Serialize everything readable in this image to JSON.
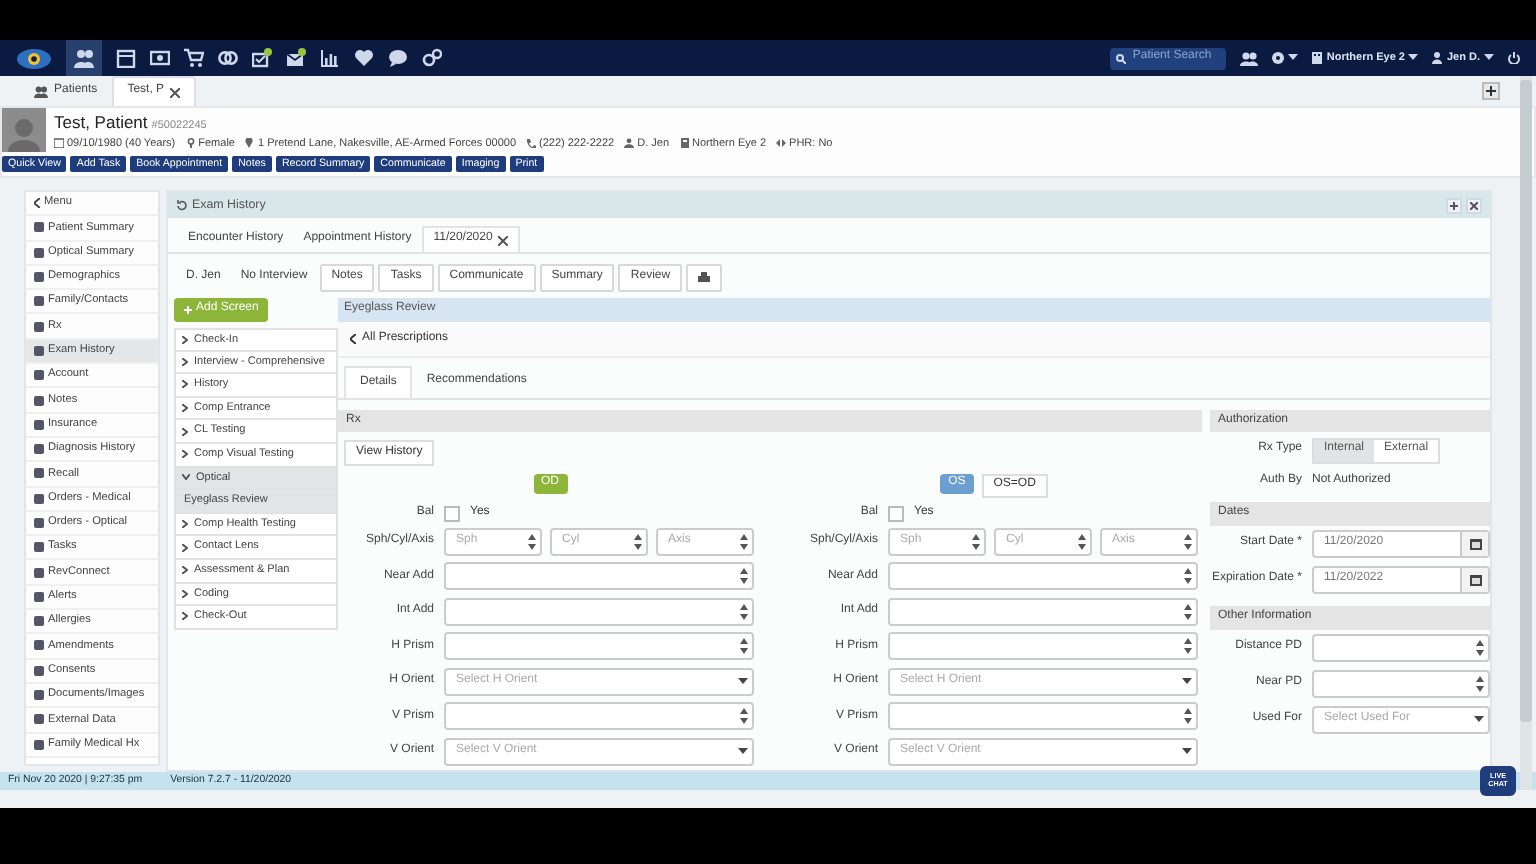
{
  "nav": {
    "search_placeholder": "Patient Search",
    "location": "Northern Eye 2",
    "user": "Jen D."
  },
  "tabs": [
    {
      "label": "Patients",
      "selected": false,
      "closable": false
    },
    {
      "label": "Test, P",
      "selected": true,
      "closable": true
    }
  ],
  "patient": {
    "name": "Test, Patient",
    "id": "#50022245",
    "details": [
      {
        "kind": "dob",
        "text": "09/10/1980 (40 Years)"
      },
      {
        "kind": "sex",
        "text": "Female"
      },
      {
        "kind": "address",
        "text": "1 Pretend Lane, Nakesville, AE-Armed Forces 00000"
      },
      {
        "kind": "phone",
        "text": "(222) 222-2222"
      },
      {
        "kind": "provider",
        "text": "D. Jen"
      },
      {
        "kind": "location",
        "text": "Northern Eye 2"
      },
      {
        "kind": "phr",
        "text": "PHR: No"
      }
    ]
  },
  "actions": [
    "Quick View",
    "Add Task",
    "Book Appointment",
    "Notes",
    "Record Summary",
    "Communicate",
    "Imaging",
    "Print"
  ],
  "menu": {
    "back": "Menu",
    "items": [
      {
        "label": "Patient Summary",
        "selected": false
      },
      {
        "label": "Optical Summary",
        "selected": false
      },
      {
        "label": "Demographics",
        "selected": false
      },
      {
        "label": "Family/Contacts",
        "selected": false
      },
      {
        "label": "Rx",
        "selected": false
      },
      {
        "label": "Exam History",
        "selected": true
      },
      {
        "label": "Account",
        "selected": false
      },
      {
        "label": "Notes",
        "selected": false
      },
      {
        "label": "Insurance",
        "selected": false
      },
      {
        "label": "Diagnosis History",
        "selected": false
      },
      {
        "label": "Recall",
        "selected": false
      },
      {
        "label": "Orders - Medical",
        "selected": false
      },
      {
        "label": "Orders - Optical",
        "selected": false
      },
      {
        "label": "Tasks",
        "selected": false
      },
      {
        "label": "RevConnect",
        "selected": false
      },
      {
        "label": "Alerts",
        "selected": false
      },
      {
        "label": "Allergies",
        "selected": false
      },
      {
        "label": "Amendments",
        "selected": false
      },
      {
        "label": "Consents",
        "selected": false
      },
      {
        "label": "Documents/Images",
        "selected": false
      },
      {
        "label": "External Data",
        "selected": false
      },
      {
        "label": "Family Medical Hx",
        "selected": false
      }
    ]
  },
  "exam": {
    "title": "Exam History",
    "tabs": [
      {
        "label": "Encounter History",
        "selected": false,
        "closable": false
      },
      {
        "label": "Appointment History",
        "selected": false,
        "closable": false
      },
      {
        "label": "11/20/2020",
        "selected": true,
        "closable": true
      }
    ],
    "info": [
      "D. Jen",
      "No Interview"
    ],
    "buttons": [
      "Notes",
      "Tasks",
      "Communicate",
      "Summary",
      "Review"
    ],
    "add_screen": "Add Screen",
    "screens": [
      {
        "label": "Check-In",
        "expanded": false
      },
      {
        "label": "Interview - Comprehensive",
        "expanded": false
      },
      {
        "label": "History",
        "expanded": false
      },
      {
        "label": "Comp Entrance",
        "expanded": false
      },
      {
        "label": "CL Testing",
        "expanded": false
      },
      {
        "label": "Comp Visual Testing",
        "expanded": false
      },
      {
        "label": "Optical",
        "expanded": true,
        "children": [
          {
            "label": "Eyeglass Review",
            "selected": true
          }
        ]
      },
      {
        "label": "Comp Health Testing",
        "expanded": false
      },
      {
        "label": "Contact Lens",
        "expanded": false
      },
      {
        "label": "Assessment & Plan",
        "expanded": false
      },
      {
        "label": "Coding",
        "expanded": false
      },
      {
        "label": "Check-Out",
        "expanded": false
      }
    ],
    "review": {
      "title": "Eyeglass Review",
      "back": "All Prescriptions",
      "tabs": [
        {
          "label": "Details",
          "selected": true
        },
        {
          "label": "Recommendations",
          "selected": false
        }
      ],
      "rx_title": "Rx",
      "view_history": "View History",
      "eyes": [
        {
          "label": "OD",
          "color": "#8db53a",
          "bal": {
            "label": "Bal",
            "option": "Yes",
            "checked": false
          },
          "fields": [
            {
              "label": "Sph/Cyl/Axis",
              "kind": "triple",
              "placeholders": [
                "Sph",
                "Cyl",
                "Axis"
              ]
            },
            {
              "label": "Near Add",
              "kind": "spin"
            },
            {
              "label": "Int Add",
              "kind": "spin"
            },
            {
              "label": "H Prism",
              "kind": "spin"
            },
            {
              "label": "H Orient",
              "kind": "select",
              "placeholder": "Select H Orient"
            },
            {
              "label": "V Prism",
              "kind": "spin"
            },
            {
              "label": "V Orient",
              "kind": "select",
              "placeholder": "Select V Orient"
            }
          ]
        },
        {
          "label": "OS",
          "color": "#6a9fd0",
          "copy_button": "OS=OD",
          "bal": {
            "label": "Bal",
            "option": "Yes",
            "checked": false
          },
          "fields": [
            {
              "label": "Sph/Cyl/Axis",
              "kind": "triple",
              "placeholders": [
                "Sph",
                "Cyl",
                "Axis"
              ]
            },
            {
              "label": "Near Add",
              "kind": "spin"
            },
            {
              "label": "Int Add",
              "kind": "spin"
            },
            {
              "label": "H Prism",
              "kind": "spin"
            },
            {
              "label": "H Orient",
              "kind": "select",
              "placeholder": "Select H Orient"
            },
            {
              "label": "V Prism",
              "kind": "spin"
            },
            {
              "label": "V Orient",
              "kind": "select",
              "placeholder": "Select V Orient"
            }
          ]
        }
      ],
      "authorization": {
        "title": "Authorization",
        "rx_type_label": "Rx Type",
        "rx_types": [
          {
            "label": "Internal",
            "selected": true
          },
          {
            "label": "External",
            "selected": false
          }
        ],
        "auth_by_label": "Auth By",
        "auth_by": "Not Authorized"
      },
      "dates": {
        "title": "Dates",
        "fields": [
          {
            "label": "Start Date *",
            "kind": "date",
            "value": "11/20/2020"
          },
          {
            "label": "Expiration Date *",
            "kind": "date",
            "value": "11/20/2022"
          }
        ]
      },
      "other": {
        "title": "Other Information",
        "fields": [
          {
            "label": "Distance PD",
            "kind": "spin"
          },
          {
            "label": "Near PD",
            "kind": "spin"
          },
          {
            "label": "Used For",
            "kind": "select",
            "placeholder": "Select Used For"
          }
        ]
      }
    }
  },
  "footer": {
    "datetime": "Fri Nov 20 2020 | 9:27:35 pm",
    "version": "Version 7.2.7 - 11/20/2020",
    "live_chat": "LIVE CHAT"
  }
}
